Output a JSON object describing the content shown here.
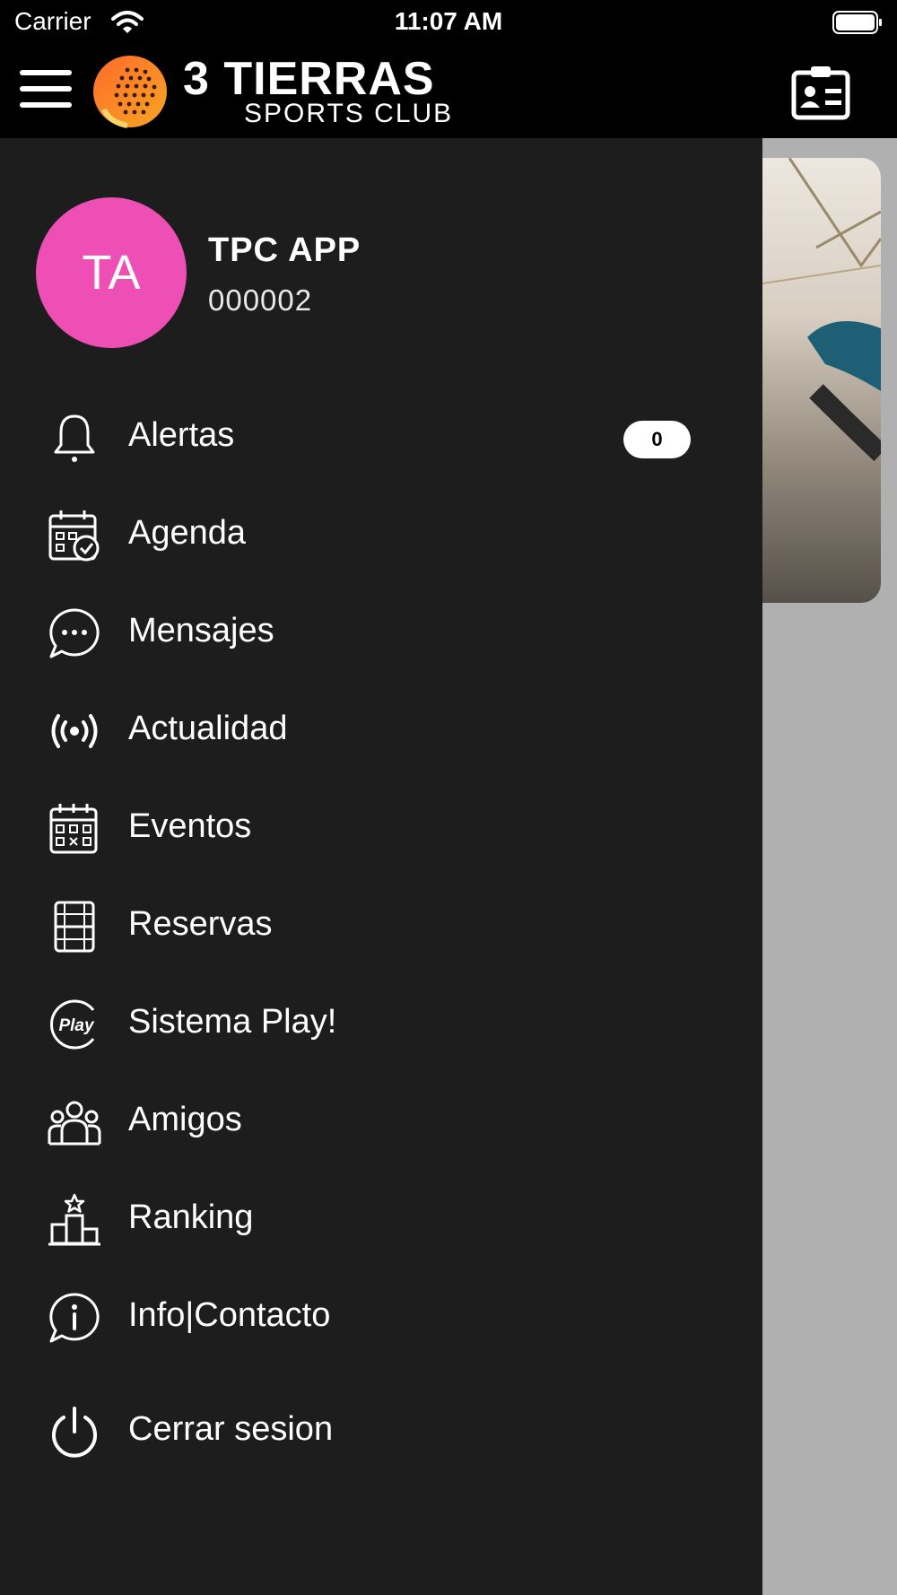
{
  "status_bar": {
    "carrier": "Carrier",
    "time": "11:07 AM"
  },
  "header": {
    "logo_line1": "3 TIERRAS",
    "logo_line2": "SPORTS CLUB"
  },
  "profile": {
    "initials": "TA",
    "name": "TPC APP",
    "member_id": "000002",
    "avatar_color": "#ed4fb4"
  },
  "menu": {
    "items": [
      {
        "label": "Alertas",
        "icon": "bell-icon",
        "badge": "0"
      },
      {
        "label": "Agenda",
        "icon": "calendar-check-icon"
      },
      {
        "label": "Mensajes",
        "icon": "chat-bubble-icon"
      },
      {
        "label": "Actualidad",
        "icon": "broadcast-icon"
      },
      {
        "label": "Eventos",
        "icon": "calendar-grid-icon"
      },
      {
        "label": "Reservas",
        "icon": "court-icon"
      },
      {
        "label": "Sistema Play!",
        "icon": "play-badge-icon"
      },
      {
        "label": "Amigos",
        "icon": "group-icon"
      },
      {
        "label": "Ranking",
        "icon": "podium-icon"
      },
      {
        "label": "Info|Contacto",
        "icon": "info-chat-icon"
      },
      {
        "label": "Cerrar sesion",
        "icon": "power-icon"
      }
    ]
  },
  "colors": {
    "drawer_bg": "#1d1d1d",
    "topbar_bg": "#000000",
    "brand_orange": "#f5822a"
  }
}
